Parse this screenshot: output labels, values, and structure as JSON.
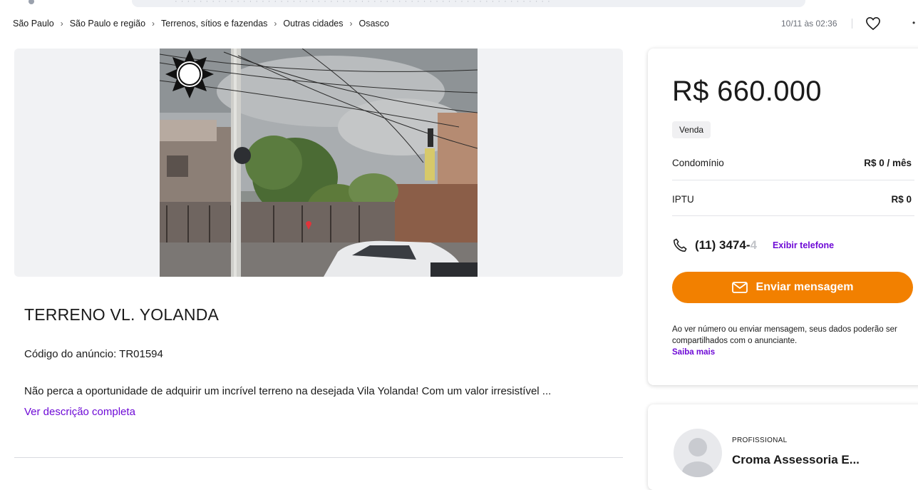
{
  "breadcrumb": {
    "items": [
      "São Paulo",
      "São Paulo e região",
      "Terrenos, sítios e fazendas",
      "Outras cidades",
      "Osasco"
    ]
  },
  "listing_meta": {
    "date": "10/11 às 02:36"
  },
  "listing": {
    "title": "TERRENO VL. YOLANDA",
    "code": "Código do anúncio: TR01594",
    "description": "Não perca a oportunidade de adquirir um incrível terreno na desejada Vila Yolanda! Com um valor irresistível ...",
    "description_more": "Ver descrição completa"
  },
  "price_card": {
    "price": "R$ 660.000",
    "badge": "Venda",
    "fees": [
      {
        "label": "Condomínio",
        "value": "R$ 0 / mês"
      },
      {
        "label": "IPTU",
        "value": "R$ 0"
      }
    ],
    "phone_visible": "(11) 3474-",
    "phone_faded": "4",
    "phone_show_label": "Exibir telefone",
    "message_button": "Enviar mensagem",
    "notice": "Ao ver número ou enviar mensagem, seus dados poderão ser compartilhados com o anunciante.",
    "notice_link": "Saiba mais"
  },
  "seller": {
    "type": "PROFISSIONAL",
    "name": "Croma Assessoria E..."
  },
  "colors": {
    "accent_orange": "#f28000",
    "link_purple": "#6e0ad6"
  },
  "icons": [
    "heart-icon",
    "share-icon",
    "phone-icon",
    "mail-icon",
    "sun-icon"
  ]
}
